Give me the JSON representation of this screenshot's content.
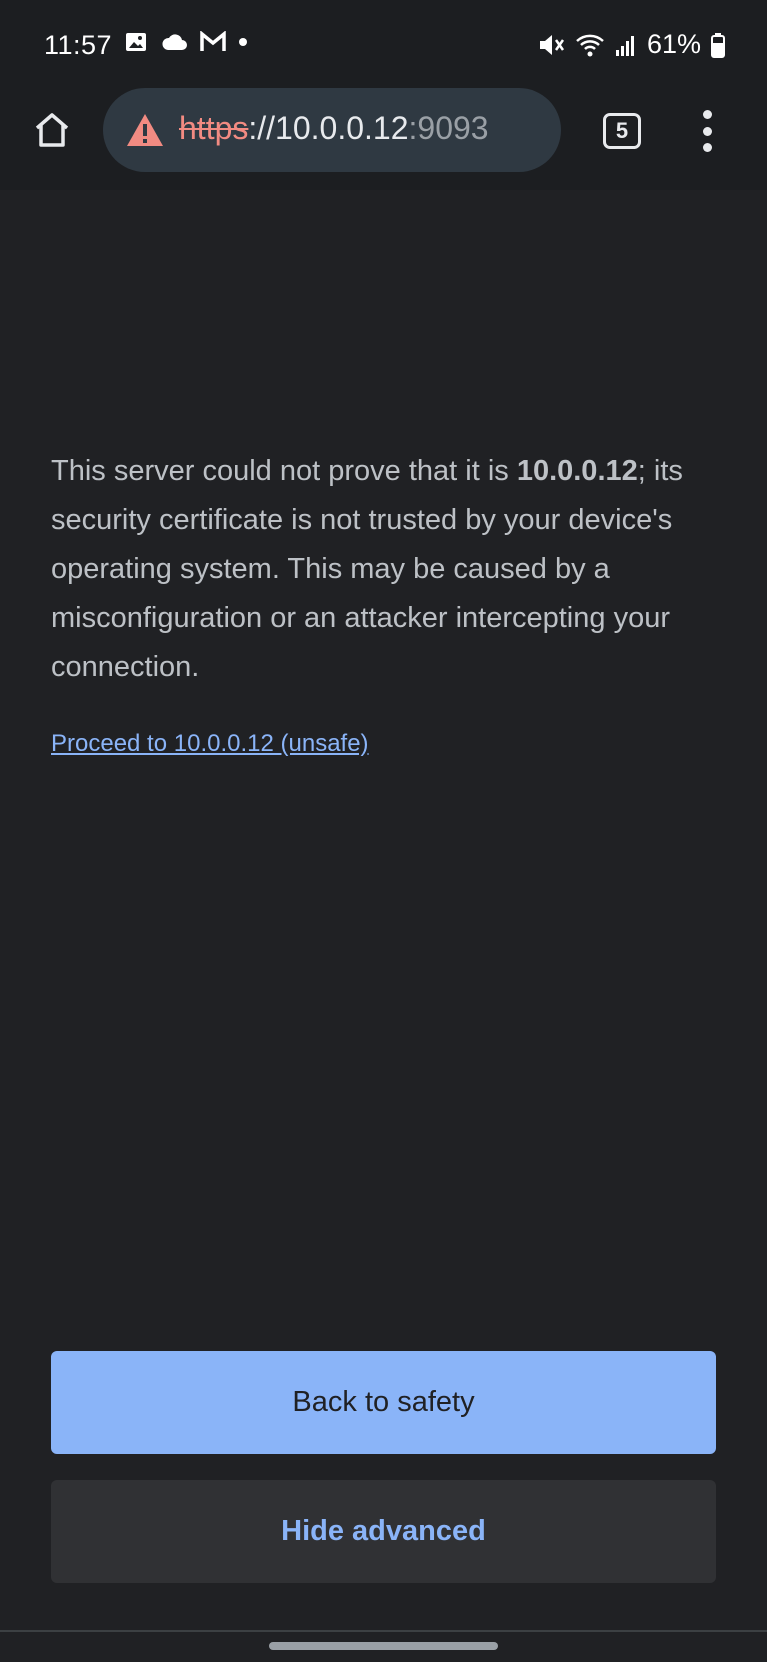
{
  "status_bar": {
    "time": "11:57",
    "battery_percent": "61%",
    "left_icons": [
      "image-icon",
      "cloud-icon",
      "gmail-icon",
      "dot-icon"
    ],
    "right_icons": [
      "mute-icon",
      "wifi-icon",
      "signal-icon",
      "battery-icon"
    ]
  },
  "browser": {
    "url_scheme": "https",
    "url_sep": "://",
    "url_host": "10.0.0.12",
    "url_port": ":9093",
    "tab_count": "5"
  },
  "interstitial": {
    "text_before": "This server could not prove that it is ",
    "host_bold": "10.0.0.12",
    "text_after": "; its security certificate is not trusted by your device's operating system. This may be caused by a misconfiguration or an attacker intercepting your connection.",
    "proceed_link": "Proceed to 10.0.0.12 (unsafe)",
    "back_button": "Back to safety",
    "hide_button": "Hide advanced"
  },
  "colors": {
    "background": "#202124",
    "accent": "#8ab4f8",
    "warning": "#f28b82"
  }
}
